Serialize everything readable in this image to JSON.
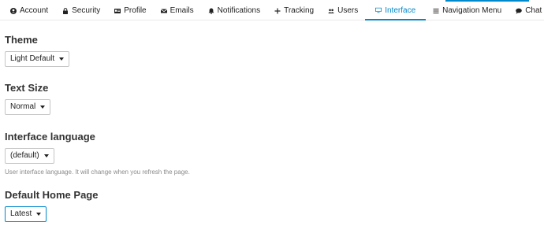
{
  "tabs": [
    {
      "label": "Account",
      "icon": "user-circle-icon",
      "active": false
    },
    {
      "label": "Security",
      "icon": "lock-icon",
      "active": false
    },
    {
      "label": "Profile",
      "icon": "id-card-icon",
      "active": false
    },
    {
      "label": "Emails",
      "icon": "envelope-icon",
      "active": false
    },
    {
      "label": "Notifications",
      "icon": "bell-icon",
      "active": false
    },
    {
      "label": "Tracking",
      "icon": "plus-icon",
      "active": false
    },
    {
      "label": "Users",
      "icon": "users-icon",
      "active": false
    },
    {
      "label": "Interface",
      "icon": "desktop-icon",
      "active": true
    },
    {
      "label": "Navigation Menu",
      "icon": "bars-icon",
      "active": false
    },
    {
      "label": "Chat",
      "icon": "comment-icon",
      "active": false
    }
  ],
  "theme": {
    "heading": "Theme",
    "value": "Light Default"
  },
  "text_size": {
    "heading": "Text Size",
    "value": "Normal"
  },
  "language": {
    "heading": "Interface language",
    "value": "(default)",
    "hint": "User interface language. It will change when you refresh the page."
  },
  "home_page": {
    "heading": "Default Home Page",
    "value": "Latest"
  },
  "colors": {
    "accent": "#0088cc"
  }
}
